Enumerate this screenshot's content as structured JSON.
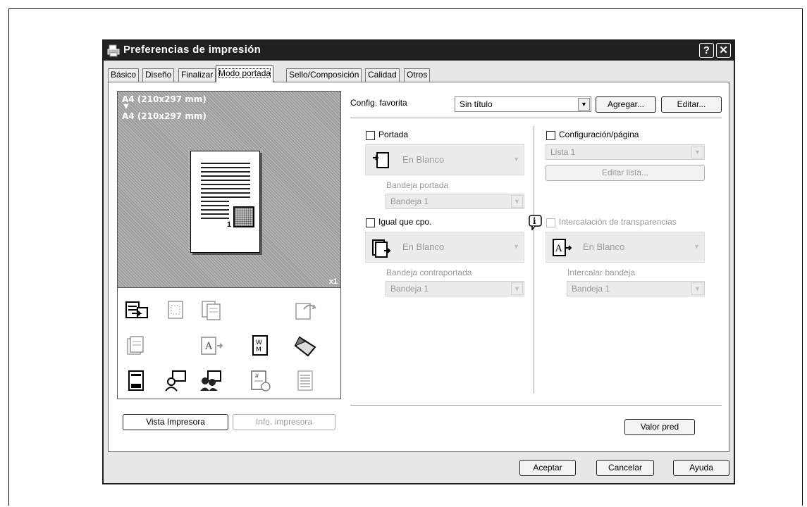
{
  "window": {
    "title": "Preferencias de impresión",
    "help_label": "?",
    "close_label": "✕"
  },
  "tabs": [
    {
      "label": "Básico"
    },
    {
      "label": "Diseño"
    },
    {
      "label": "Finalizar"
    },
    {
      "label": "Modo portada",
      "active": true
    },
    {
      "label": "Sello/Composición"
    },
    {
      "label": "Calidad"
    },
    {
      "label": "Otros"
    }
  ],
  "preview": {
    "paper_top": "A4 (210x297 mm)",
    "arrow": "▼",
    "paper_bottom": "A4 (210x297 mm)",
    "page_number": "1",
    "copies": "x1"
  },
  "left_buttons": {
    "printer_view": "Vista Impresora",
    "printer_info": "Info. impresora"
  },
  "favorites": {
    "label": "Config. favorita",
    "value": "Sin título",
    "add_label": "Agregar...",
    "edit_label": "Editar..."
  },
  "cover": {
    "checkbox_label": "Portada",
    "type_value": "En Blanco",
    "tray_label": "Bandeja portada",
    "tray_value": "Bandeja 1"
  },
  "back_cover": {
    "checkbox_label": "Igual que cpo.",
    "type_value": "En Blanco",
    "tray_label": "Bandeja contraportada",
    "tray_value": "Bandeja 1"
  },
  "per_page": {
    "checkbox_label": "Configuración/página",
    "list_value": "Lista 1",
    "edit_list_label": "Editar lista..."
  },
  "transparency": {
    "checkbox_label": "Intercalación de transparencias",
    "type_value": "En Blanco",
    "tray_label": "Intercalar bandeja",
    "tray_value": "Bandeja 1"
  },
  "defaults_button": "Valor pred",
  "footer": {
    "ok": "Aceptar",
    "cancel": "Cancelar",
    "help": "Ayuda"
  }
}
